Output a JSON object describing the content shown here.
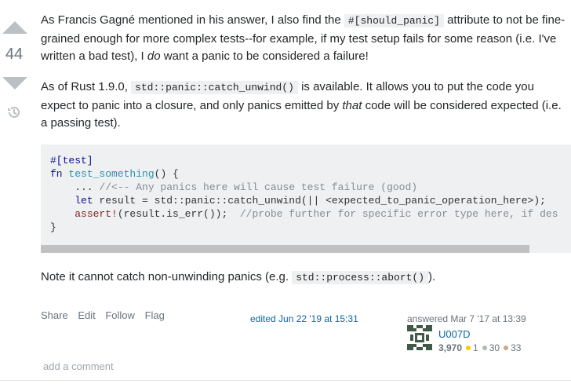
{
  "vote": {
    "score": "44",
    "up_icon": "arrow-up-icon",
    "down_icon": "arrow-down-icon",
    "history_icon": "history-icon"
  },
  "answer": {
    "p1_a": "As Francis Gagné mentioned in his answer, I also find the ",
    "p1_code": "#[should_panic]",
    "p1_b": " attribute to not be fine-grained enough for more complex tests--for example, if my test setup fails for some reason (i.e. I've written a bad test), I ",
    "p1_em": "do",
    "p1_c": " want a panic to be considered a failure!",
    "p2_a": "As of Rust 1.9.0, ",
    "p2_code": "std::panic::catch_unwind()",
    "p2_b": " is available. It allows you to put the code you expect to panic into a closure, and only panics emitted by ",
    "p2_em": "that",
    "p2_c": " code will be considered expected (i.e. a passing test).",
    "code": {
      "l1": "#[test]",
      "l2_kw": "fn",
      "l2_name": "test_something",
      "l2_rest": "() {",
      "l3_a": "    ... ",
      "l3_cmt": "//<-- Any panics here will cause test failure (good)",
      "l4_kw": "let",
      "l4_rest": " result = std::panic::catch_unwind(|| <expected_to_panic_operation_here>);",
      "l5_mac": "assert!",
      "l5_rest": "(result.is_err());  ",
      "l5_cmt": "//probe further for specific error type here, if des",
      "l6": "}"
    },
    "p3_a": "Note it cannot catch non-unwinding panics (e.g. ",
    "p3_code": "std::process::abort()",
    "p3_b": ")."
  },
  "menu": {
    "share": "Share",
    "edit": "Edit",
    "follow": "Follow",
    "flag": "Flag"
  },
  "edited": "edited Jun 22 '19 at 15:31",
  "user": {
    "answered": "answered Mar 7 '17 at 13:39",
    "name": "U007D",
    "rep": "3,970",
    "gold": "1",
    "silver": "30",
    "bronze": "33"
  },
  "add_comment": "add a comment",
  "colors": {
    "link": "#0c65a5",
    "code_bg": "#eff0f1",
    "vote_arrow": "#bbc0c4"
  }
}
